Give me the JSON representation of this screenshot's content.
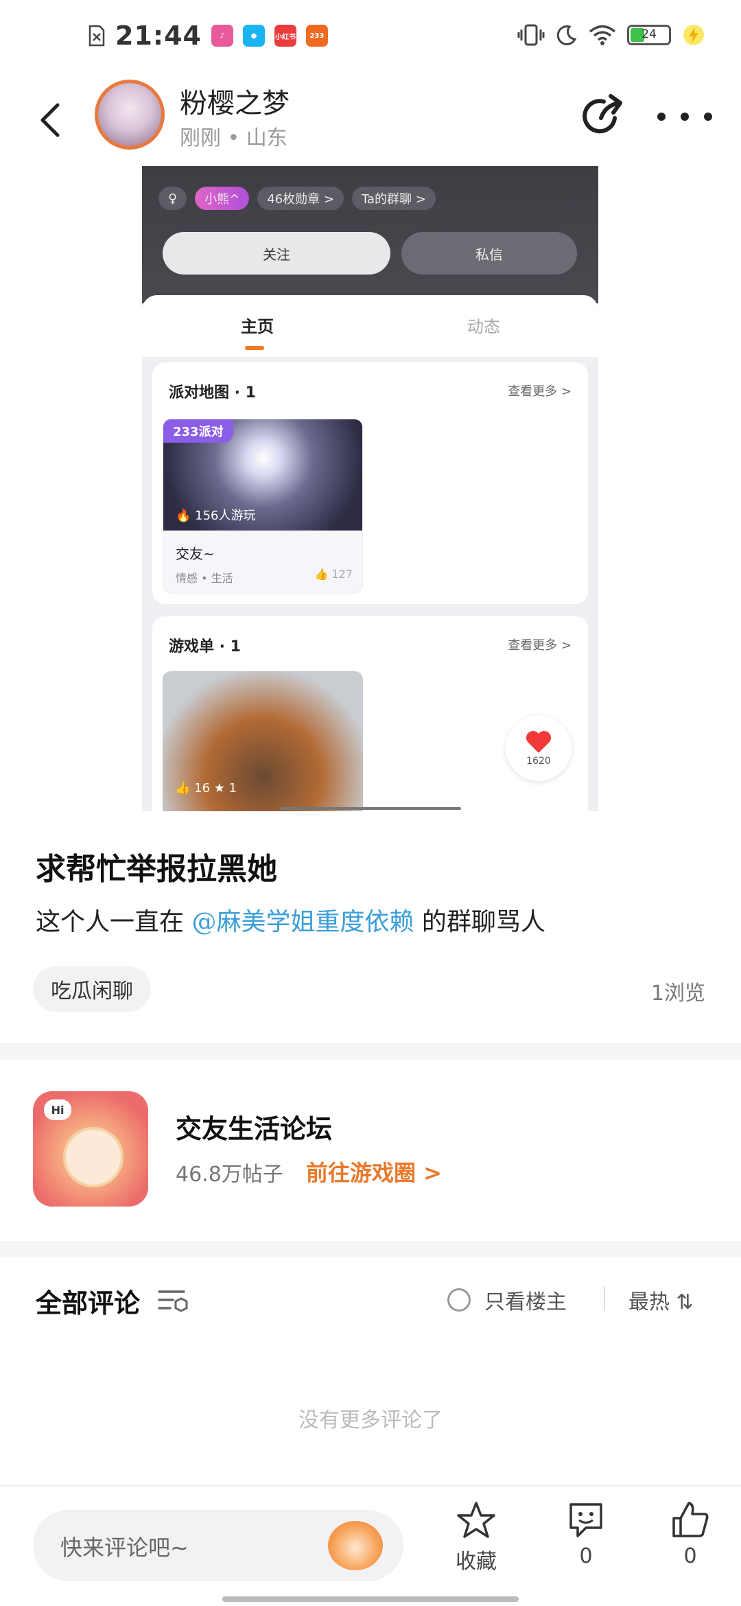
{
  "status_bar": {
    "time": "21:44",
    "battery": "24",
    "apps": [
      {
        "name": "app-badge-1",
        "label": "",
        "color": "#e85a9b"
      },
      {
        "name": "qq-app",
        "label": "",
        "color": "#19b4f2"
      },
      {
        "name": "app-badge-3",
        "label": "小红书",
        "color": "#ea3c3c"
      },
      {
        "name": "app-233",
        "label": "233",
        "color": "#f06a22"
      }
    ]
  },
  "header": {
    "author_name": "粉樱之梦",
    "author_meta": "刚刚 • 山东"
  },
  "embedded": {
    "chip_1": "小熊^",
    "chip_2": "46枚勋章 >",
    "chip_3": "Ta的群聊 >",
    "follow_label": "关注",
    "chat_label": "私信",
    "tab_home": "主页",
    "tab_feed": "动态",
    "card1_title": "派对地图 · 1",
    "card1_more": "查看更多 >",
    "map_badge": "233派对",
    "map_players": "156人游玩",
    "map_name": "交友~",
    "map_tag": "情感 • 生活",
    "map_likes": "127",
    "card2_title": "游戏单 · 1",
    "card2_more": "查看更多 >",
    "game_likes": "16",
    "game_stars": "1",
    "heart_count": "1620"
  },
  "post": {
    "title": "求帮忙举报拉黑她",
    "body_prefix": "这个人一直在 ",
    "mention": "@麻美学姐重度依赖",
    "body_suffix": " 的群聊骂人",
    "topic_tag": "吃瓜闲聊",
    "views": "1浏览"
  },
  "forum": {
    "name": "交友生活论坛",
    "posts": "46.8万帖子",
    "go_label": "前往游戏圈 >",
    "icon_hi": "Hi"
  },
  "comments": {
    "title": "全部评论",
    "only_owner": "只看楼主",
    "sort": "最热 ⇅",
    "empty": "没有更多评论了"
  },
  "bottom_bar": {
    "placeholder": "快来评论吧~",
    "favorite_label": "收藏",
    "comment_count": "0",
    "like_count": "0"
  },
  "colors": {
    "accent": "#e9782a",
    "mention": "#3a9ed8",
    "tab_indicator": "#f07a22"
  }
}
